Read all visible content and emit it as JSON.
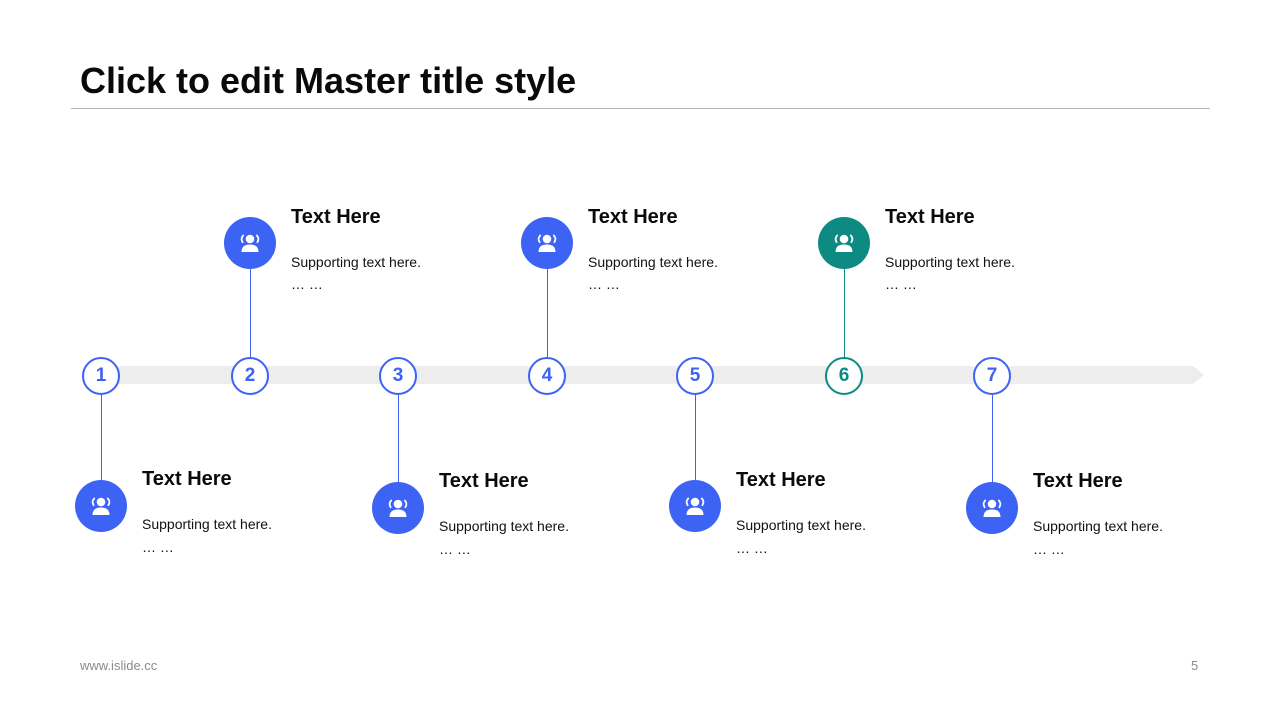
{
  "slide": {
    "title": "Click to edit Master title style",
    "footer_url": "www.islide.cc",
    "page_number": "5"
  },
  "colors": {
    "blue": "#3d63f5",
    "teal": "#0d8a82",
    "track": "#ededed"
  },
  "steps": [
    {
      "number": "1",
      "heading": "Text Here",
      "support": "Supporting text here.",
      "dots": "… …",
      "icon": "user-group-icon",
      "color": "blue"
    },
    {
      "number": "2",
      "heading": "Text Here",
      "support": "Supporting text here.",
      "dots": "… …",
      "icon": "user-group-icon",
      "color": "blue"
    },
    {
      "number": "3",
      "heading": "Text Here",
      "support": "Supporting text here.",
      "dots": "… …",
      "icon": "user-group-icon",
      "color": "blue"
    },
    {
      "number": "4",
      "heading": "Text Here",
      "support": "Supporting text here.",
      "dots": "… …",
      "icon": "user-group-icon",
      "color": "blue"
    },
    {
      "number": "5",
      "heading": "Text Here",
      "support": "Supporting text here.",
      "dots": "… …",
      "icon": "user-group-icon",
      "color": "blue"
    },
    {
      "number": "6",
      "heading": "Text Here",
      "support": "Supporting text here.",
      "dots": "… …",
      "icon": "user-group-icon",
      "color": "teal"
    },
    {
      "number": "7",
      "heading": "Text Here",
      "support": "Supporting text here.",
      "dots": "… …",
      "icon": "user-group-icon",
      "color": "blue"
    }
  ]
}
